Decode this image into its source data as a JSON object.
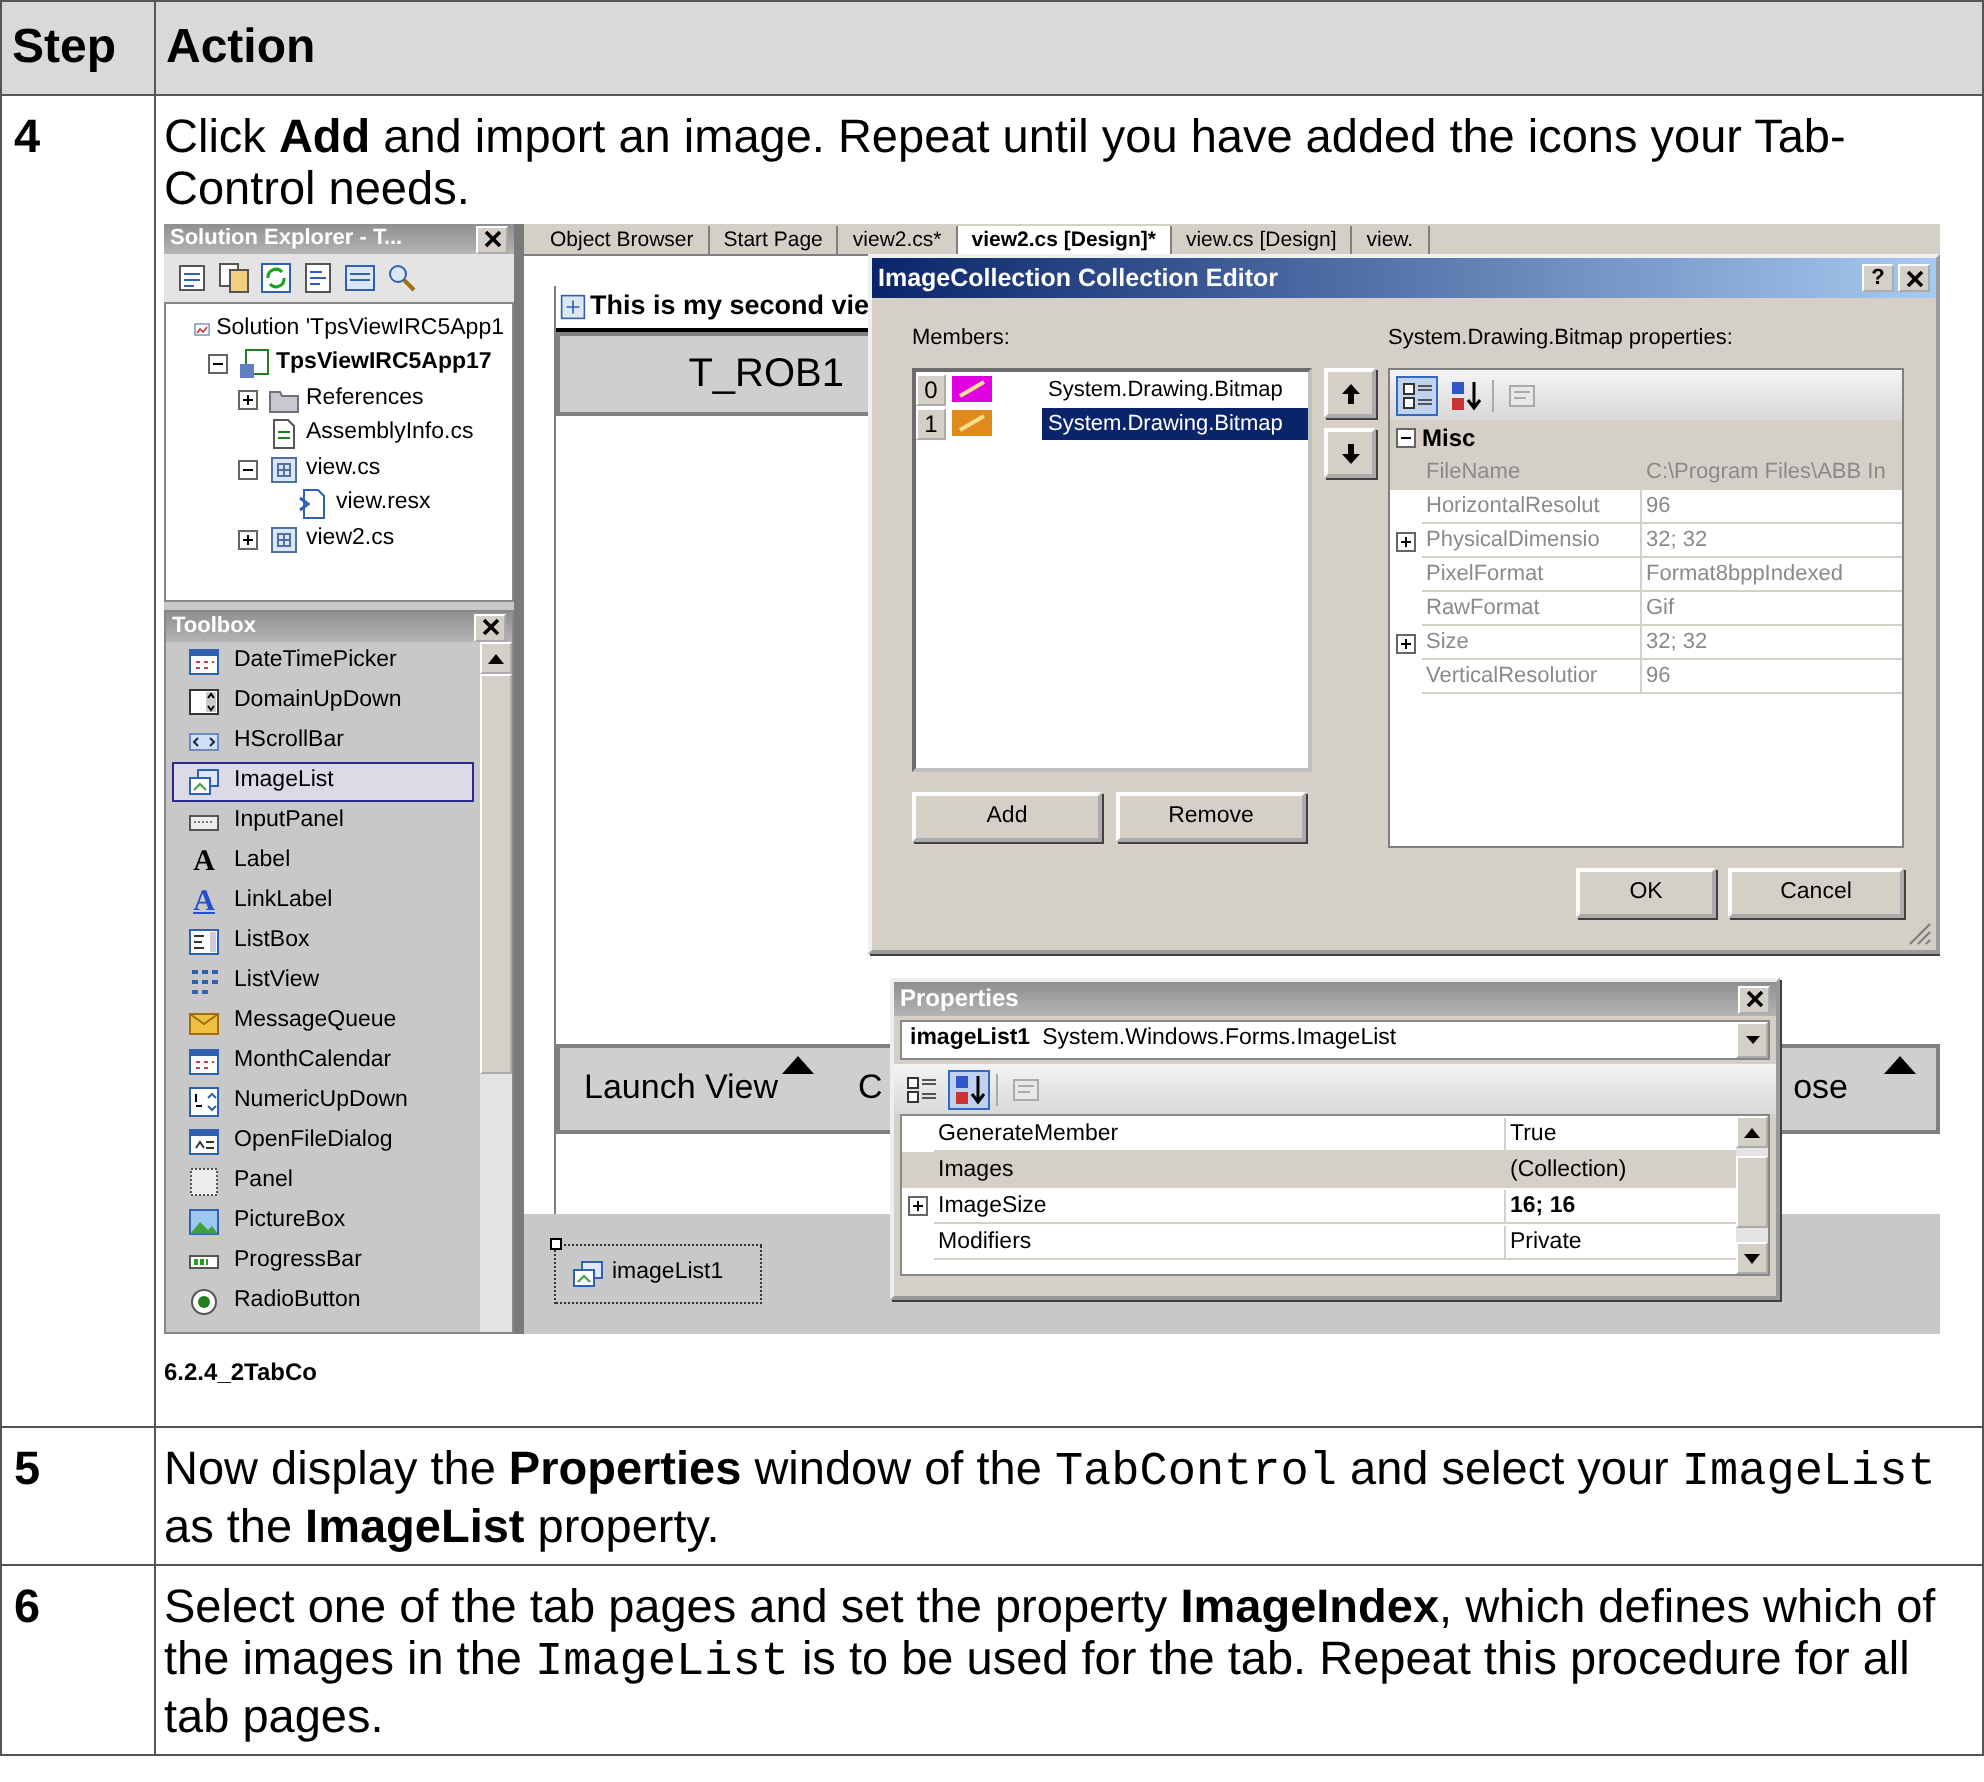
{
  "table": {
    "columns": [
      {
        "label": "Step"
      },
      {
        "label": "Action"
      }
    ],
    "rows": [
      {
        "step": "4",
        "text": [
          {
            "kind": "text",
            "text": "Click **Add** and import an image. Repeat until you have added the icons your Tab-Control needs."
          }
        ],
        "figure": {
          "solution_explorer": {
            "title": "Solution Explorer - T...",
            "tree": [
              {
                "label": "Solution 'TpsViewIRC5App1",
                "kind": "solution",
                "children": [
                  {
                    "label": "TpsViewIRC5App17",
                    "kind": "project",
                    "expanded": true,
                    "children": [
                      {
                        "label": "References",
                        "kind": "folder",
                        "expanded": false
                      },
                      {
                        "label": "AssemblyInfo.cs",
                        "kind": "code-file"
                      },
                      {
                        "label": "view.cs",
                        "kind": "form-file",
                        "expanded": true,
                        "children": [
                          {
                            "label": "view.resx",
                            "kind": "resource-file"
                          }
                        ]
                      },
                      {
                        "label": "view2.cs",
                        "kind": "form-file",
                        "expanded": false
                      }
                    ]
                  }
                ]
              }
            ]
          },
          "toolbox": {
            "title": "Toolbox",
            "items": [
              {
                "label": "DateTimePicker",
                "kind": "calendar",
                "selected": false
              },
              {
                "label": "DomainUpDown",
                "kind": "spinner",
                "selected": false
              },
              {
                "label": "HScrollBar",
                "kind": "scrollbar",
                "selected": false
              },
              {
                "label": "ImageList",
                "kind": "imagelist",
                "selected": true
              },
              {
                "label": "InputPanel",
                "kind": "keyboard",
                "selected": false
              },
              {
                "label": "Label",
                "kind": "letter",
                "glyph": "A",
                "selected": false
              },
              {
                "label": "LinkLabel",
                "kind": "link",
                "glyph": "A",
                "selected": false
              },
              {
                "label": "ListBox",
                "kind": "list",
                "selected": false
              },
              {
                "label": "ListView",
                "kind": "grid",
                "selected": false
              },
              {
                "label": "MessageQueue",
                "kind": "envelope",
                "selected": false
              },
              {
                "label": "MonthCalendar",
                "kind": "calendar",
                "selected": false
              },
              {
                "label": "NumericUpDown",
                "kind": "numeric",
                "selected": false
              },
              {
                "label": "OpenFileDialog",
                "kind": "dialog",
                "selected": false
              },
              {
                "label": "Panel",
                "kind": "panel",
                "selected": false
              },
              {
                "label": "PictureBox",
                "kind": "picture",
                "selected": false
              },
              {
                "label": "ProgressBar",
                "kind": "progress",
                "selected": false
              },
              {
                "label": "RadioButton",
                "kind": "radio",
                "selected": false
              }
            ]
          },
          "tabs": [
            {
              "label": "Object Browser",
              "selected": false
            },
            {
              "label": "Start Page",
              "selected": false
            },
            {
              "label": "view2.cs*",
              "selected": false
            },
            {
              "label": "view2.cs [Design]*",
              "selected": true
            },
            {
              "label": "view.cs [Design]",
              "selected": false
            },
            {
              "label": "view.",
              "selected": false
            }
          ],
          "designer": {
            "form_title": "This is my second vie",
            "tab": "T_ROB1",
            "bottom_tabs": [
              {
                "label": "Launch View",
                "caret": true
              },
              {
                "label": "C",
                "caret": false
              },
              {
                "label": "ose",
                "caret": true
              }
            ],
            "tray": [
              {
                "label": "imageList1"
              }
            ]
          },
          "collection_editor": {
            "title": "ImageCollection Collection Editor",
            "help": "?",
            "members_label": "Members:",
            "members": [
              {
                "index": "0",
                "label": "System.Drawing.Bitmap",
                "color": "#e000e0",
                "selected": false
              },
              {
                "index": "1",
                "label": "System.Drawing.Bitmap",
                "color": "#e08a1e",
                "selected": true
              }
            ],
            "add": "Add",
            "remove": "Remove",
            "properties_label": "System.Drawing.Bitmap properties:",
            "toolbar": [
              {
                "kind": "categorized",
                "selected": true
              },
              {
                "kind": "alphabetical",
                "selected": false
              },
              {
                "kind": "pages",
                "selected": false
              }
            ],
            "category": {
              "label": "Misc",
              "expanded": true,
              "rows": [
                {
                  "name": "FileName",
                  "value": "C:\\Program Files\\ABB In",
                  "selected": true
                },
                {
                  "name": "HorizontalResolut",
                  "value": "96",
                  "selected": false
                },
                {
                  "name": "PhysicalDimensio",
                  "value": "32; 32",
                  "selected": false,
                  "expanded": false
                },
                {
                  "name": "PixelFormat",
                  "value": "Format8bppIndexed",
                  "selected": false
                },
                {
                  "name": "RawFormat",
                  "value": "Gif",
                  "selected": false
                },
                {
                  "name": "Size",
                  "value": "32; 32",
                  "selected": false,
                  "expanded": false
                },
                {
                  "name": "VerticalResolutior",
                  "value": "96",
                  "selected": false
                }
              ]
            },
            "ok": "OK",
            "cancel": "Cancel"
          },
          "properties_window": {
            "title": "Properties",
            "object_name": "imageList1",
            "object_type": "System.Windows.Forms.ImageList",
            "toolbar": [
              {
                "kind": "categorized",
                "selected": false
              },
              {
                "kind": "alphabetical",
                "selected": true
              },
              {
                "kind": "pages",
                "selected": false
              }
            ],
            "rows": [
              {
                "name": "GenerateMember",
                "value": "True",
                "selected": false,
                "modified": false
              },
              {
                "name": "Images",
                "value": "(Collection)",
                "selected": true,
                "modified": false
              },
              {
                "name": "ImageSize",
                "value": "16; 16",
                "selected": false,
                "modified": true,
                "expanded": false
              },
              {
                "name": "Modifiers",
                "value": "Private",
                "selected": false,
                "modified": false
              }
            ]
          }
        },
        "caption": "6.2.4_2TabCo"
      },
      {
        "step": "5",
        "text": [
          {
            "kind": "text",
            "text": "Now display the **Properties** window of the "
          },
          {
            "kind": "code",
            "text": "TabControl"
          },
          {
            "kind": "text",
            "text": " and select your "
          },
          {
            "kind": "code",
            "text": "ImageList"
          },
          {
            "kind": "text",
            "text": " as the **ImageList** property."
          }
        ]
      },
      {
        "step": "6",
        "text": [
          {
            "kind": "text",
            "text": "Select one of the tab pages and set the property **ImageIndex**, which defines which of the images in the "
          },
          {
            "kind": "code",
            "text": "ImageList"
          },
          {
            "kind": "text",
            "text": " is to be used for the tab. Repeat this procedure for all tab pages."
          }
        ]
      }
    ]
  }
}
